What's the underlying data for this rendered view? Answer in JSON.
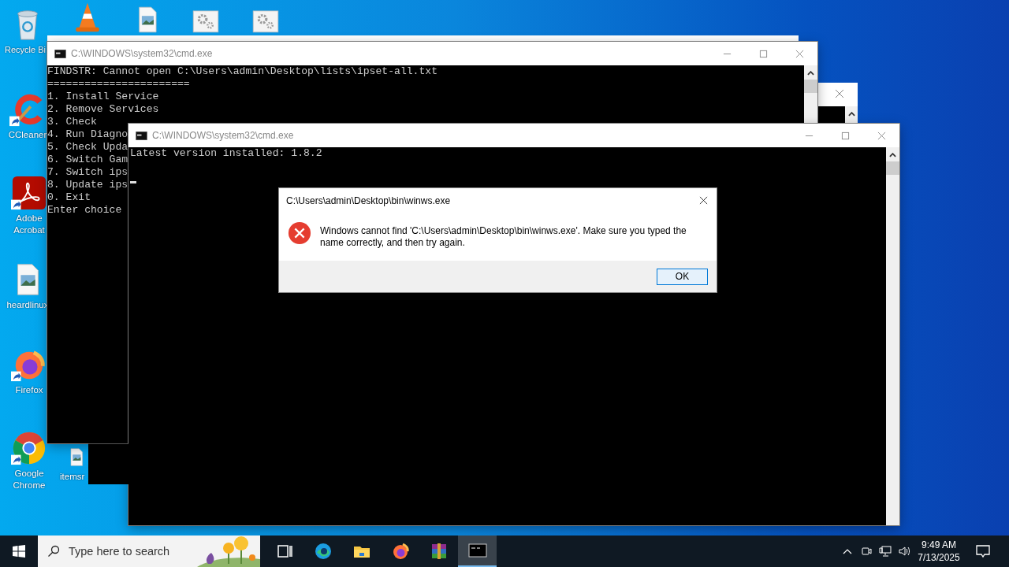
{
  "desktop_icons": [
    {
      "kind": "recycle-bin",
      "label": "Recycle Bi",
      "shortcut": false
    },
    {
      "kind": "cone",
      "shortcut": false
    },
    {
      "kind": "image-file",
      "shortcut": false
    },
    {
      "kind": "gear-file",
      "shortcut": false
    },
    {
      "kind": "gear-file",
      "shortcut": false
    },
    {
      "kind": "ccleaner",
      "label": "CCleaner",
      "shortcut": true
    },
    {
      "kind": "acrobat",
      "label": "Adobe Acrobat",
      "shortcut": true
    },
    {
      "kind": "image-file",
      "label": "heardlinux",
      "shortcut": false
    },
    {
      "kind": "firefox",
      "label": "Firefox",
      "shortcut": true
    },
    {
      "kind": "chrome",
      "label": "Google Chrome",
      "shortcut": true
    },
    {
      "kind": "image-file",
      "label": "itemsr",
      "shortcut": false
    }
  ],
  "consoles": [
    {
      "title": "C:\\WINDOWS\\system32\\cmd.exe",
      "cursor": false,
      "lines": [
        "FINDSTR: Cannot open C:\\Users\\admin\\Desktop\\lists\\ipset-all.txt",
        "=======================",
        "1. Install Service",
        "2. Remove Services",
        "3. Check",
        "4. Run Diagno",
        "5. Check Upda",
        "6. Switch Gam",
        "7. Switch ips",
        "8. Update ips",
        "0. Exit",
        "Enter choice"
      ]
    },
    {
      "title": "C:\\WINDOWS\\system32\\cmd.exe",
      "cursor": true,
      "lines": [
        "Latest version installed: 1.8.2"
      ]
    }
  ],
  "dialog": {
    "title": "C:\\Users\\admin\\Desktop\\bin\\winws.exe",
    "message": "Windows cannot find 'C:\\Users\\admin\\Desktop\\bin\\winws.exe'. Make sure you typed the name correctly, and then try again.",
    "button": "OK"
  },
  "taskbar": {
    "search": {
      "placeholder": "Type here to search"
    },
    "apps": [
      {
        "kind": "task-view",
        "selected": false
      },
      {
        "kind": "edge",
        "selected": false
      },
      {
        "kind": "explorer",
        "selected": false
      },
      {
        "kind": "firefox",
        "selected": false
      },
      {
        "kind": "winrar",
        "selected": false
      },
      {
        "kind": "cmd",
        "selected": true
      }
    ],
    "clock": {
      "time": "9:49 AM",
      "date": "7/13/2025"
    }
  }
}
